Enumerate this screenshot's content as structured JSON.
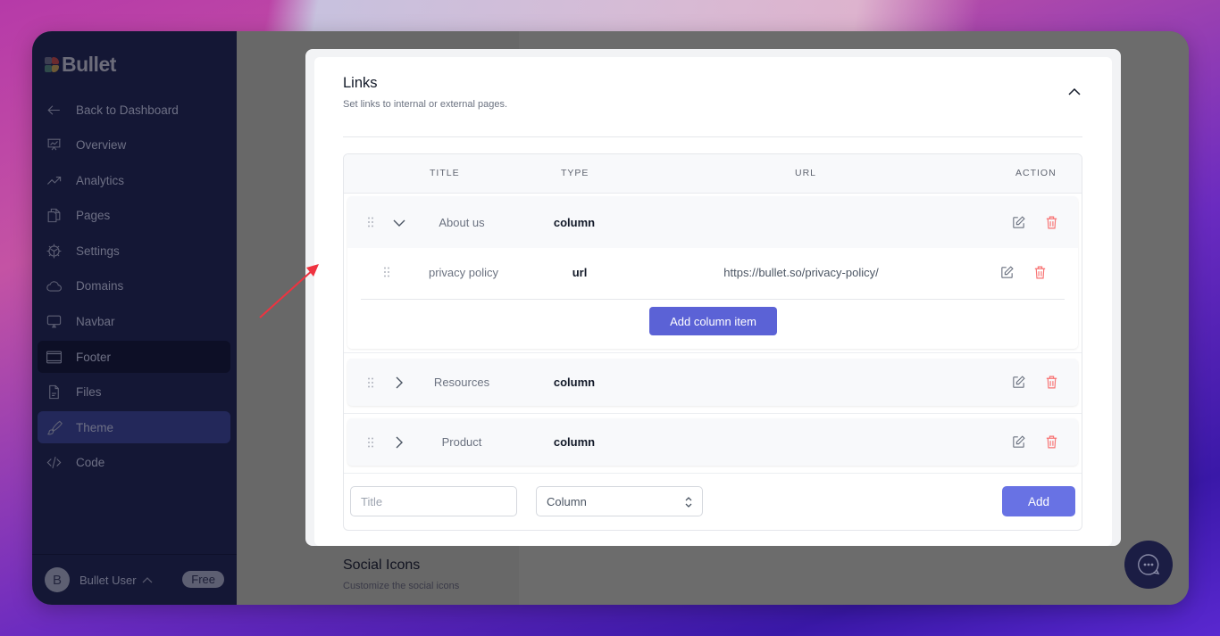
{
  "app": {
    "brand": "Bullet"
  },
  "sidebar": {
    "items": [
      {
        "label": "Back to Dashboard",
        "icon": "arrow-left-icon"
      },
      {
        "label": "Overview",
        "icon": "presentation-chart-icon"
      },
      {
        "label": "Analytics",
        "icon": "trending-up-icon"
      },
      {
        "label": "Pages",
        "icon": "documents-icon"
      },
      {
        "label": "Settings",
        "icon": "cog-icon"
      },
      {
        "label": "Domains",
        "icon": "cloud-icon"
      },
      {
        "label": "Navbar",
        "icon": "desktop-icon"
      },
      {
        "label": "Footer",
        "icon": "window-icon"
      },
      {
        "label": "Files",
        "icon": "file-text-icon"
      },
      {
        "label": "Theme",
        "icon": "paintbrush-icon"
      },
      {
        "label": "Code",
        "icon": "code-icon"
      }
    ],
    "user": {
      "initial": "B",
      "name": "Bullet User",
      "plan": "Free"
    }
  },
  "links_section": {
    "title": "Links",
    "description": "Set links to internal or external pages.",
    "columns": [
      "TITLE",
      "TYPE",
      "URL",
      "ACTION"
    ],
    "groups": [
      {
        "title": "About us",
        "type": "column",
        "expanded": true,
        "items": [
          {
            "title": "privacy policy",
            "type": "url",
            "url": "https://bullet.so/privacy-policy/"
          }
        ],
        "add_item_label": "Add column item"
      },
      {
        "title": "Resources",
        "type": "column",
        "expanded": false
      },
      {
        "title": "Product",
        "type": "column",
        "expanded": false
      }
    ],
    "new_link": {
      "title_placeholder": "Title",
      "title_value": "",
      "type_selected": "Column",
      "add_label": "Add"
    }
  },
  "social_section": {
    "title": "Social Icons",
    "description": "Customize the social icons"
  },
  "colors": {
    "accent": "#5b62d6",
    "delete": "#f87171",
    "sidebar_bg": "#141735",
    "annotation_arrow": "#ef3340"
  }
}
